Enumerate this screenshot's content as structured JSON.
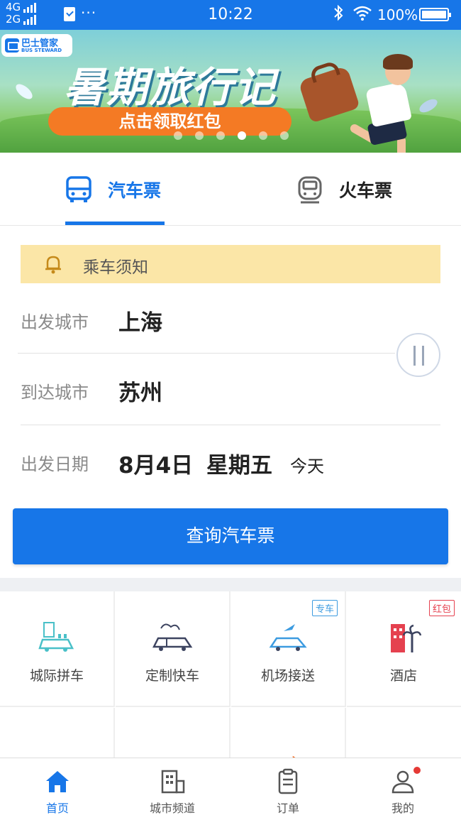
{
  "status_bar": {
    "network_top": "4G",
    "network_bottom": "2G",
    "overflow": "···",
    "time": "10:22",
    "battery": "100%"
  },
  "banner": {
    "brand_name": "巴士管家",
    "brand_sub": "BUS STEWARD",
    "title": "暑期旅行记",
    "cta": "点击领取红包",
    "slide_count": 6,
    "active_slide": 4
  },
  "tabs": [
    {
      "label": "汽车票",
      "icon": "bus-icon",
      "active": true
    },
    {
      "label": "火车票",
      "icon": "train-icon",
      "active": false
    }
  ],
  "notice": {
    "label": "乘车须知",
    "icon": "bell-icon"
  },
  "form": {
    "depart_label": "出发城市",
    "depart_value": "上海",
    "arrive_label": "到达城市",
    "arrive_value": "苏州",
    "date_label": "出发日期",
    "date_value": "8月4日",
    "weekday": "星期五",
    "today": "今天"
  },
  "search_button": "查询汽车票",
  "services": [
    {
      "label": "城际拼车",
      "icon": "intercity-carpool-icon",
      "badge": ""
    },
    {
      "label": "定制快车",
      "icon": "custom-express-icon",
      "badge": ""
    },
    {
      "label": "机场接送",
      "icon": "airport-transfer-icon",
      "badge": "专车"
    },
    {
      "label": "酒店",
      "icon": "hotel-icon",
      "badge": "红包"
    }
  ],
  "bottom_nav": [
    {
      "label": "首页",
      "icon": "home-icon",
      "active": true
    },
    {
      "label": "城市频道",
      "icon": "city-channel-icon",
      "active": false
    },
    {
      "label": "订单",
      "icon": "order-icon",
      "active": false
    },
    {
      "label": "我的",
      "icon": "profile-icon",
      "active": false
    }
  ],
  "colors": {
    "primary": "#1776e8",
    "notice_bg": "#fbe6a7",
    "cta": "#f47a24",
    "badge_blue": "#3c9be0",
    "badge_red": "#e5414f"
  }
}
